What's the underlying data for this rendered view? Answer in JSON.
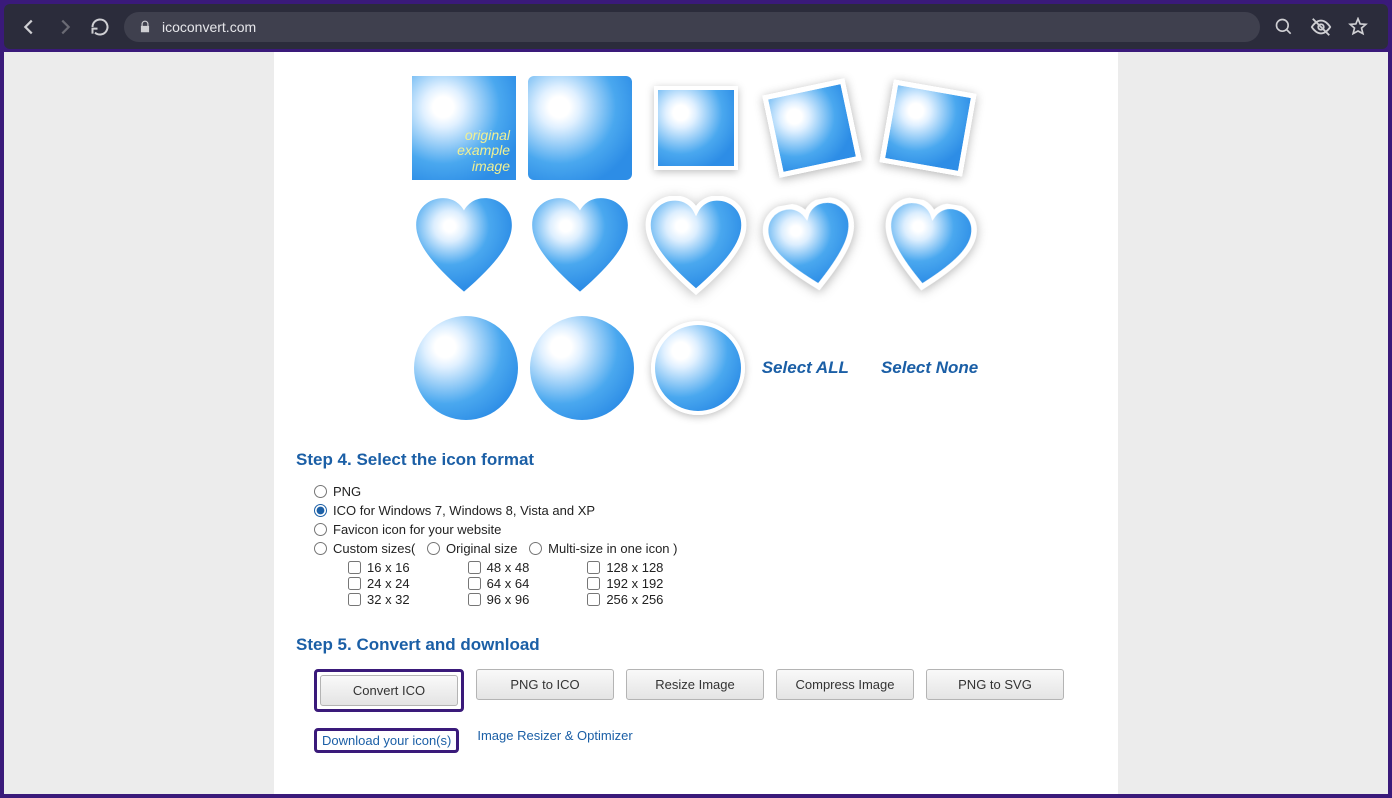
{
  "browser": {
    "url": "icoconvert.com"
  },
  "original": {
    "line1": "original",
    "line2": "example",
    "line3": "image"
  },
  "selectAll": "Select ALL",
  "selectNone": "Select None",
  "step4": {
    "heading": "Step 4. Select the icon format",
    "png": "PNG",
    "ico": "ICO for Windows 7, Windows 8, Vista and XP",
    "fav": "Favicon icon for your website",
    "custom": "Custom sizes(",
    "origSize": "Original size",
    "multi": "Multi-size in one icon )",
    "sizes": {
      "c1": [
        "16 x 16",
        "24 x 24",
        "32 x 32"
      ],
      "c2": [
        "48 x 48",
        "64 x 64",
        "96 x 96"
      ],
      "c3": [
        "128 x 128",
        "192 x 192",
        "256 x 256"
      ]
    },
    "selected": "ico"
  },
  "step5": {
    "heading": "Step 5. Convert and download",
    "buttons": {
      "convert": "Convert ICO",
      "png2ico": "PNG to ICO",
      "resize": "Resize Image",
      "compress": "Compress Image",
      "png2svg": "PNG to SVG"
    },
    "download": "Download your icon(s)",
    "resizer": "Image Resizer & Optimizer"
  }
}
